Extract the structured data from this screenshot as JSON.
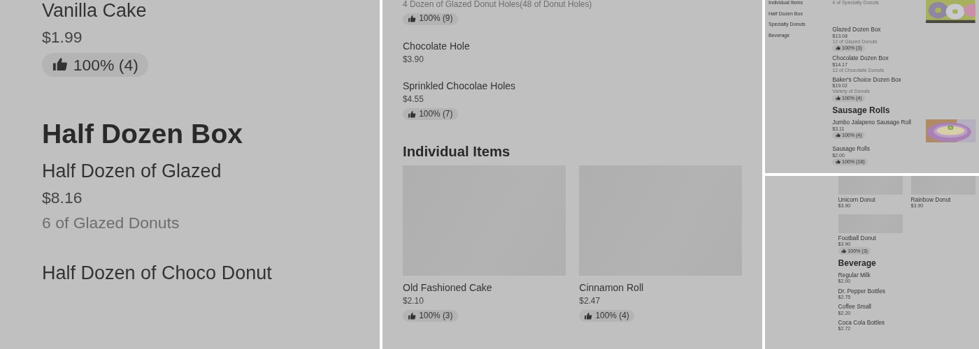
{
  "panels": [
    {
      "kind": "large",
      "sections": [
        {
          "kind": "list",
          "items": [
            {
              "name": "Vanilla Cake",
              "price": "$1.99",
              "rating": "100% (4)"
            }
          ]
        },
        {
          "title": "Half Dozen Box",
          "kind": "list",
          "items": [
            {
              "name": "Half Dozen of Glazed",
              "price": "$8.16",
              "description": "6 of Glazed Donuts"
            },
            {
              "name": "Half Dozen of Choco Donut"
            }
          ]
        }
      ]
    },
    {
      "kind": "medium",
      "sections": [
        {
          "kind": "list",
          "items": [
            {
              "description": "4 Dozen of Glazed Donut Holes(48 of Donut Holes)",
              "rating": "100% (9)"
            },
            {
              "name": "Chocolate Hole",
              "price": "$3.90"
            },
            {
              "name": "Sprinkled Chocolae Holes",
              "price": "$4.55",
              "rating": "100% (7)"
            }
          ]
        },
        {
          "title": "Individual Items",
          "kind": "grid",
          "items": [
            {
              "name": "Old Fashioned Cake",
              "price": "$2.10",
              "rating": "100% (3)"
            },
            {
              "name": "Cinnamon Roll",
              "price": "$2.47",
              "rating": "100% (4)"
            }
          ]
        }
      ]
    },
    {
      "kind": "small",
      "sidebar": {
        "items": [
          "Individual Items",
          "Half Dozen Box",
          "Specialty Donuts",
          "Beverage"
        ]
      },
      "sections": [
        {
          "kind": "list",
          "items": [
            {
              "description": "4 of Specialty Donuts",
              "kind": "picture"
            },
            {
              "name": "Glazed Dozen Box",
              "price": "$13.08",
              "description": "12 of Glazed Donuts",
              "rating": "100% (3)"
            },
            {
              "name": "Chocolate Dozen Box",
              "price": "$14.17",
              "description": "12 of Chocolate Donuts"
            },
            {
              "name": "Baker's Choice Dozen Box",
              "price": "$19.02",
              "description": "Variety of Donuts",
              "rating": "100% (4)"
            }
          ]
        },
        {
          "title": "Sausage Rolls",
          "kind": "list",
          "items": [
            {
              "name": "Jumbo Jalapeno Sausage Roll",
              "price": "$3.11",
              "rating": "100% (4)",
              "kind": "picture"
            },
            {
              "name": "Sausage Rolls",
              "price": "$2.00",
              "rating": "100% (18)"
            }
          ]
        }
      ]
    },
    {
      "kind": "small",
      "sections": [
        {
          "kind": "grid",
          "items": [
            {
              "name": "Unicorn Donut",
              "price": "$3.90"
            },
            {
              "name": "Rainbow Donut",
              "price": "$3.90"
            },
            {
              "name": "Football Donut",
              "price": "$3.90",
              "rating": "100% (3)"
            }
          ]
        },
        {
          "title": "Beverage",
          "kind": "list",
          "items": [
            {
              "name": "Regular Milk",
              "price": "$2.00"
            },
            {
              "name": "Dr. Pepper Bottles",
              "price": "$2.75"
            },
            {
              "name": "Coffee Small",
              "price": "$2.20"
            },
            {
              "name": "Coca Cola Bottles",
              "price": "$2.72"
            }
          ]
        }
      ]
    }
  ]
}
